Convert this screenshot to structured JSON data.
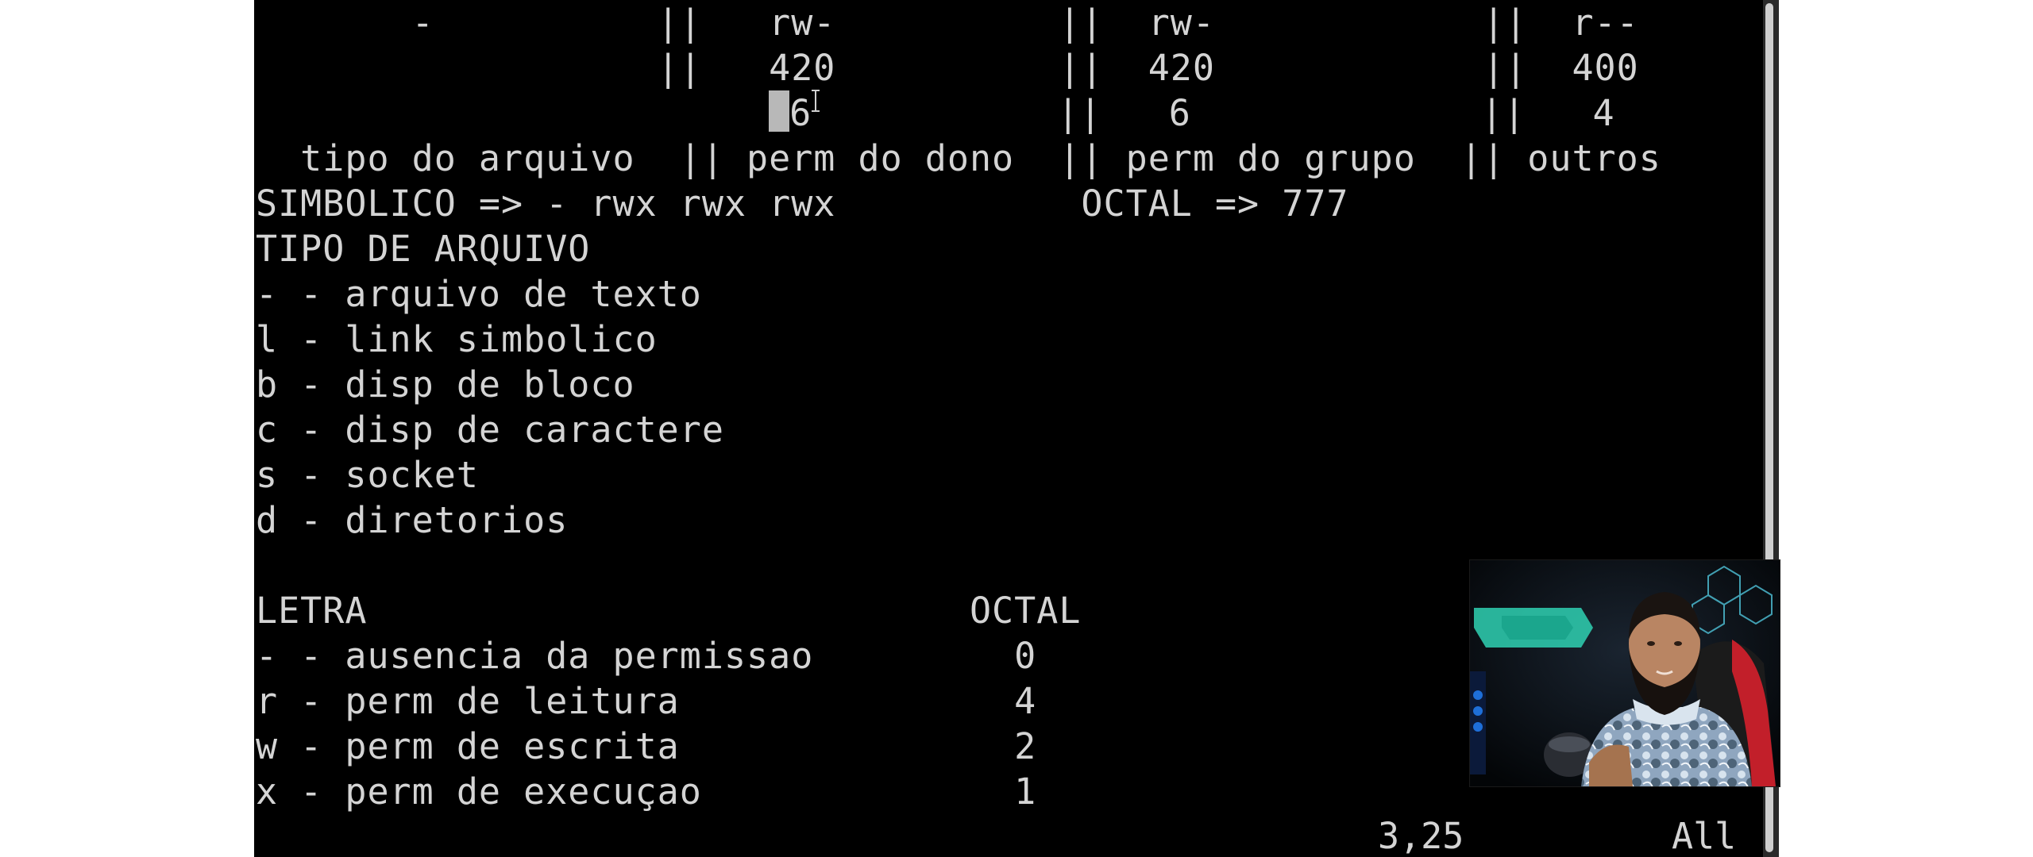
{
  "terminal": {
    "lines": [
      "       -          ||   rw-          ||  rw-            ||  r--",
      "                  ||   420          ||  420            ||  400",
      "                        6           ||   6             ||   4",
      "  tipo do arquivo  || perm do dono  || perm do grupo  || outros",
      "SIMBOLICO => - rwx rwx rwx           OCTAL => 777",
      "TIPO DE ARQUIVO",
      "- - arquivo de texto",
      "l - link simbolico",
      "b - disp de bloco",
      "c - disp de caractere",
      "s - socket",
      "d - diretorios",
      "",
      "LETRA                           OCTAL",
      "- - ausencia da permissao         0",
      "r - perm de leitura               4",
      "w - perm de escrita               2",
      "x - perm de execuçao              1"
    ],
    "line2_before_cursor": "                       ",
    "line2_after_cursor": "6           ||   6             ||   4"
  },
  "status": {
    "position": "3,25",
    "scroll": "All"
  },
  "icons": {
    "cursor": "text-cursor-block",
    "mouse": "ibeam-mouse-icon"
  },
  "colors": {
    "background": "#000000",
    "text": "#d4d4d4",
    "cursor": "#b8b8b8"
  }
}
